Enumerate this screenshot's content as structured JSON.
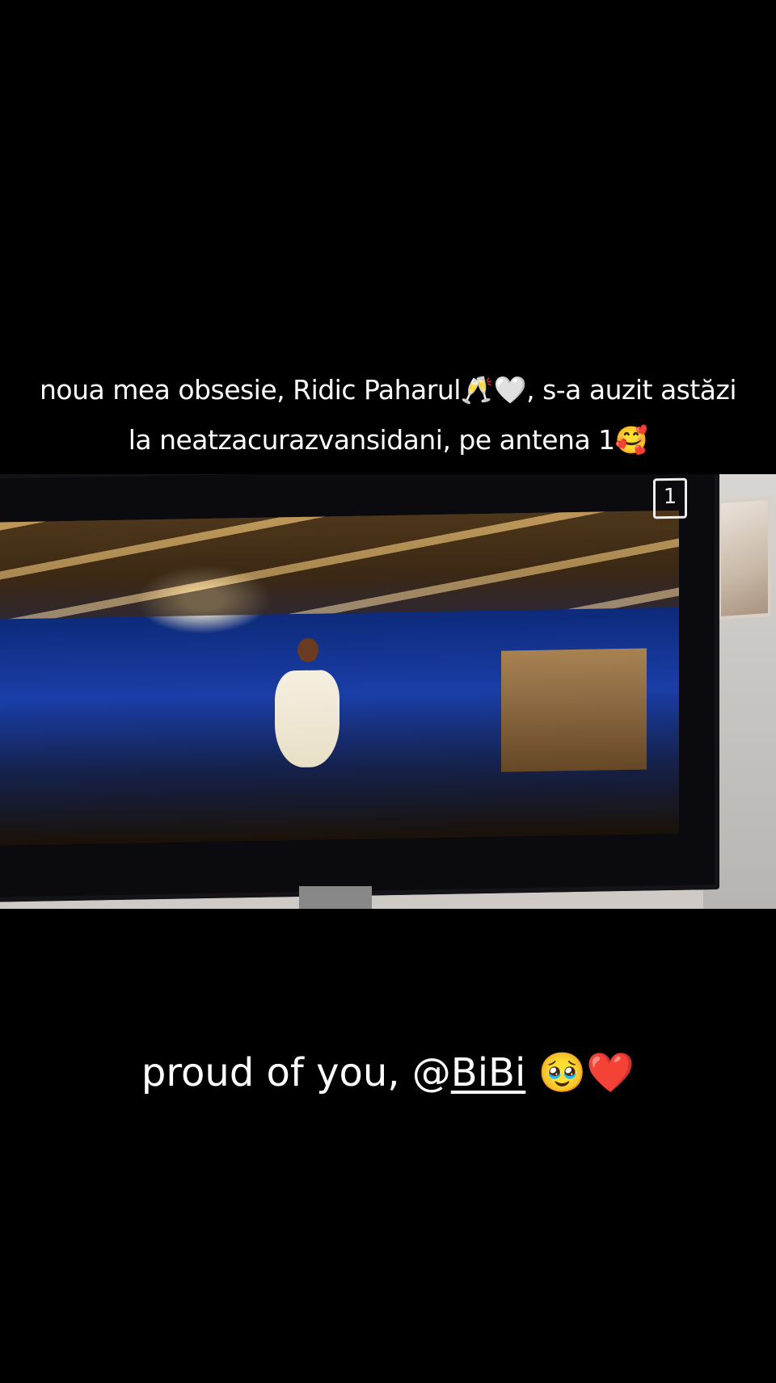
{
  "top_caption": {
    "line1": "noua mea obsesie, Ridic Paharul🥂🤍, s-a auzit astăzi",
    "line2": "la neatzacurazvansidani, pe antena 1🥰"
  },
  "tv_channel_logo": "1",
  "bottom_caption": {
    "prefix": "proud of you, @",
    "mention": "BiBi",
    "suffix": " 🥹❤️"
  },
  "icons": [
    "tv-channel-logo-icon"
  ]
}
